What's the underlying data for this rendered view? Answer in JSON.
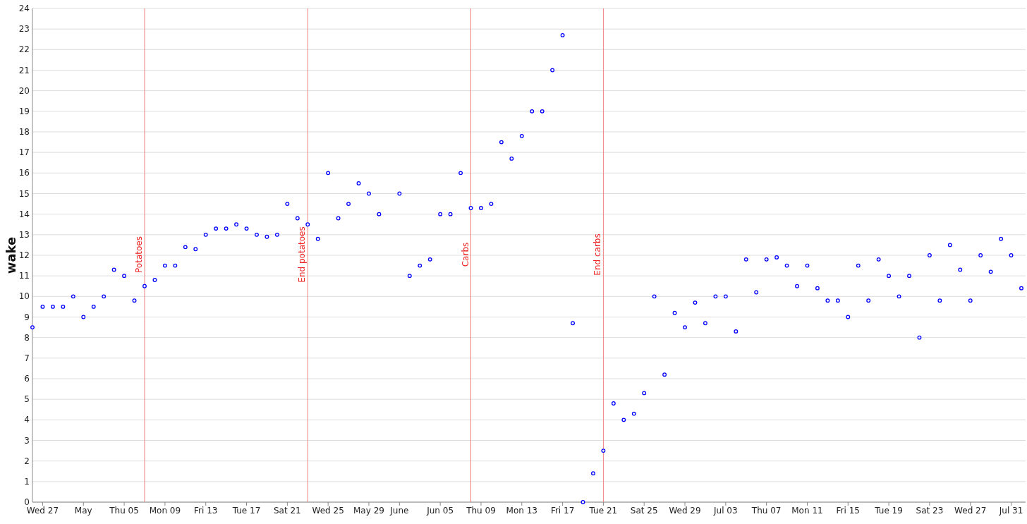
{
  "chart": {
    "chart_data": {
      "type": "scatter",
      "ylabel": "wake",
      "categories": [
        null,
        "Wed 27",
        null,
        null,
        null,
        "May",
        null,
        null,
        null,
        "Thu 05",
        null,
        null,
        null,
        "Mon 09",
        null,
        null,
        null,
        "Fri 13",
        null,
        null,
        null,
        "Tue 17",
        null,
        null,
        null,
        "Sat 21",
        null,
        null,
        null,
        "Wed 25",
        null,
        null,
        null,
        "May 29",
        null,
        null,
        "June",
        null,
        null,
        null,
        "Jun 05",
        null,
        null,
        null,
        "Thu 09",
        null,
        null,
        null,
        "Mon 13",
        null,
        null,
        null,
        "Fri 17",
        null,
        null,
        null,
        "Tue 21",
        null,
        null,
        null,
        "Sat 25",
        null,
        null,
        null,
        "Wed 29",
        null,
        null,
        null,
        "Jul 03",
        null,
        null,
        null,
        "Thu 07",
        null,
        null,
        null,
        "Mon 11",
        null,
        null,
        null,
        "Fri 15",
        null,
        null,
        null,
        "Tue 19",
        null,
        null,
        null,
        "Sat 23",
        null,
        null,
        null,
        "Wed 27",
        null,
        null,
        null,
        "Jul 31",
        null
      ],
      "ylim": [
        0,
        24
      ],
      "yticks": [
        0,
        1,
        2,
        3,
        4,
        5,
        6,
        7,
        8,
        9,
        10,
        11,
        12,
        13,
        14,
        15,
        16,
        17,
        18,
        19,
        20,
        21,
        22,
        23,
        24
      ],
      "series": [
        {
          "color": "#0000ff",
          "values": [
            8.5,
            9.5,
            9.5,
            9.5,
            10.0,
            9.0,
            9.5,
            10.0,
            11.3,
            11.0,
            9.8,
            10.5,
            10.8,
            11.5,
            11.5,
            12.4,
            12.3,
            13.0,
            13.3,
            13.3,
            13.5,
            13.3,
            13.0,
            12.9,
            13.0,
            14.5,
            13.8,
            13.5,
            12.8,
            16.0,
            13.8,
            14.5,
            15.5,
            15.0,
            14.0,
            null,
            15.0,
            11.0,
            11.5,
            11.8,
            14.0,
            14.0,
            16.0,
            14.3,
            14.3,
            14.5,
            17.5,
            16.7,
            17.8,
            19.0,
            19.0,
            21.0,
            22.7,
            8.7,
            0,
            1.4,
            2.5,
            4.8,
            4.0,
            4.3,
            5.3,
            10.0,
            6.2,
            9.2,
            8.5,
            9.7,
            8.7,
            10.0,
            10.0,
            8.3,
            11.8,
            10.2,
            11.8,
            11.9,
            11.5,
            10.5,
            11.5,
            10.4,
            9.8,
            9.8,
            9.0,
            11.5,
            9.8,
            11.8,
            11.0,
            10.0,
            11.0,
            8.0,
            12.0,
            9.8,
            12.5,
            11.3,
            9.8,
            12.0,
            11.2,
            12.8,
            12.0,
            10.4
          ]
        }
      ],
      "grid": true,
      "annotations": [
        "Potatoes",
        "End potatoes",
        "Carbs",
        "End carbs"
      ]
    }
  }
}
